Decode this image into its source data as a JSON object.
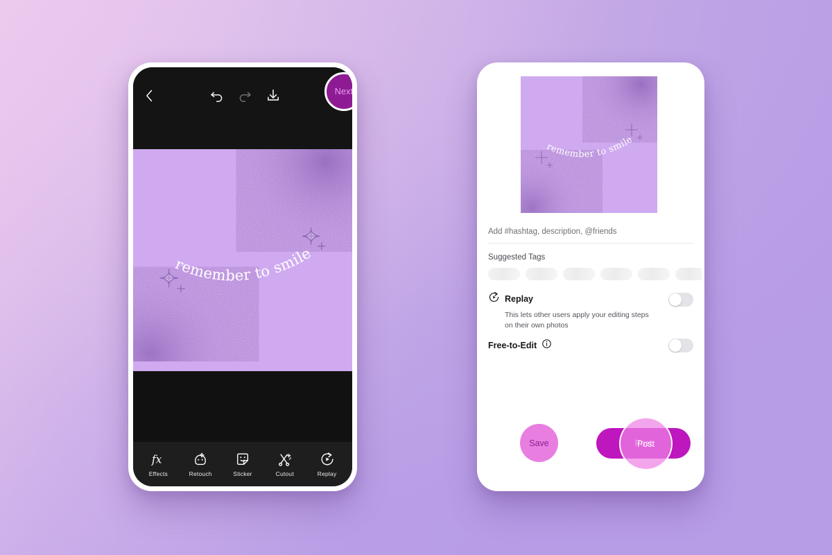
{
  "background": {
    "from": "#e8cbee",
    "to": "#b79ce7"
  },
  "editor": {
    "back_icon": "chevron-left-icon",
    "undo_icon": "undo-arrow-icon",
    "redo_icon": "redo-arrow-icon",
    "save_icon": "download-icon",
    "next_label": "Next",
    "canvas": {
      "artwork_text": "remember to smile",
      "background_color": "#cfaaf0",
      "text_color": "#ffffff"
    },
    "tools": [
      {
        "label": "Effects",
        "icon": "fx-icon"
      },
      {
        "label": "Retouch",
        "icon": "retouch-face-icon"
      },
      {
        "label": "Sticker",
        "icon": "sticker-icon"
      },
      {
        "label": "Cutout",
        "icon": "cutout-scissors-icon"
      },
      {
        "label": "Replay",
        "icon": "replay-circle-icon"
      }
    ]
  },
  "publish": {
    "preview_alt": "remember to smile",
    "caption_placeholder": "Add #hashtag, description, @friends",
    "caption_value": "",
    "suggested_tags_label": "Suggested Tags",
    "suggested_tags_placeholder_count": 7,
    "replay": {
      "icon": "replay-circle-icon",
      "title": "Replay",
      "description": "This lets other users apply your editing steps on their own photos",
      "enabled": "off"
    },
    "free_to_edit": {
      "title": "Free-to-Edit",
      "info_icon": "info-circle-icon",
      "enabled": "off"
    },
    "save_label": "Save",
    "post_label": "Post",
    "tap_indicator_label": "Post",
    "colors": {
      "save_bg": "#e87fe0",
      "save_text": "#8e1b94",
      "post_bg": "#bd17bd",
      "post_text": "#ffffff",
      "next_bg": "#8e1b94"
    }
  }
}
